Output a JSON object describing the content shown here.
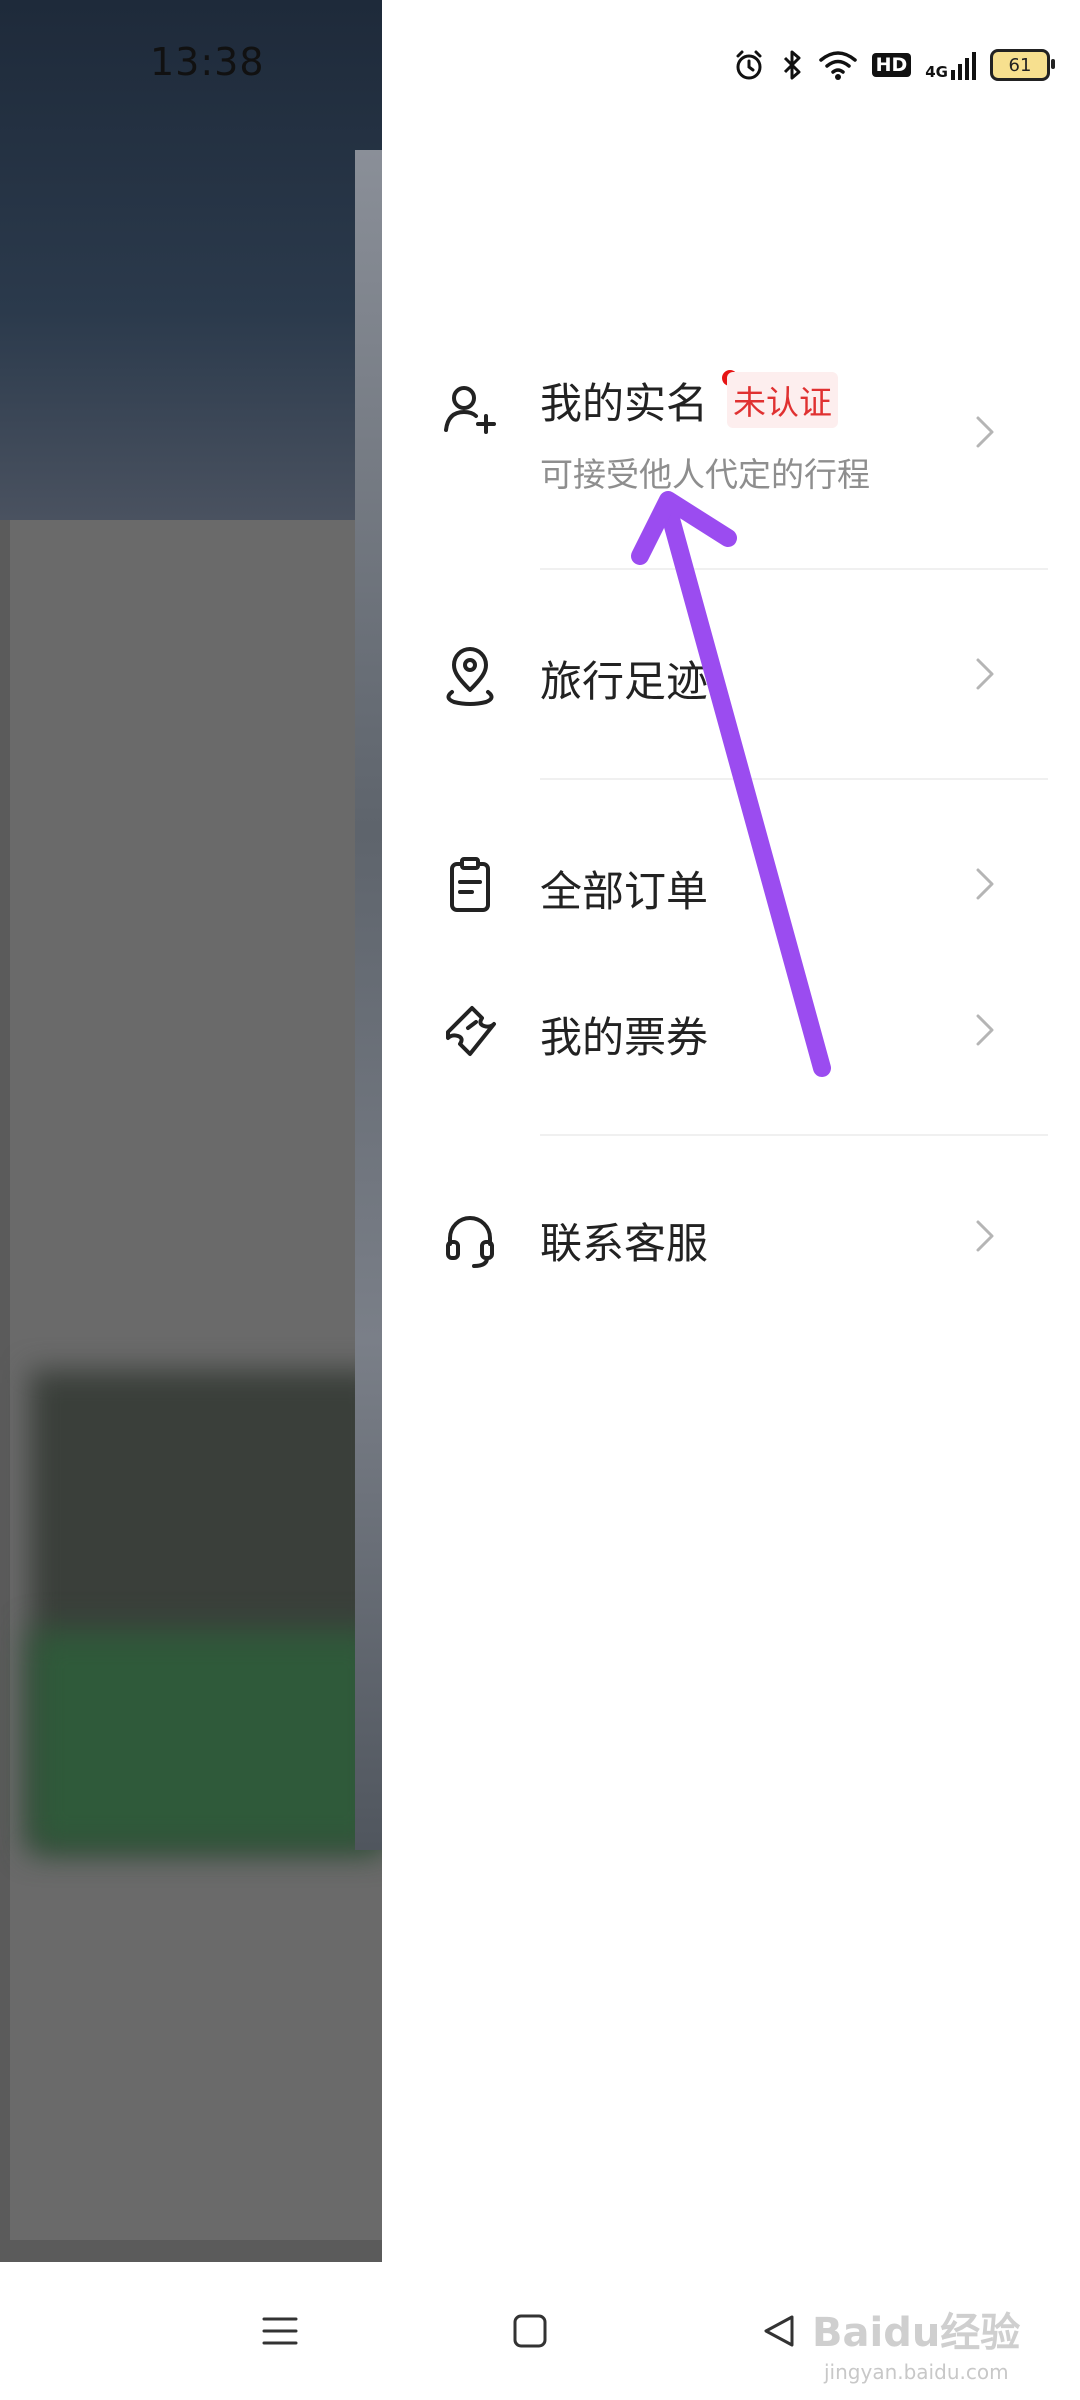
{
  "status_bar": {
    "time": "13:38",
    "battery": "61",
    "network": "4G",
    "hd": "HD"
  },
  "menu": {
    "items": [
      {
        "label": "我的实名",
        "subtitle": "可接受他人代定的行程",
        "badge": "未认证",
        "icon": "person-plus-icon"
      },
      {
        "label": "旅行足迹",
        "icon": "location-pin-icon"
      },
      {
        "label": "全部订单",
        "icon": "clipboard-icon"
      },
      {
        "label": "我的票券",
        "icon": "ticket-icon"
      },
      {
        "label": "联系客服",
        "icon": "headset-icon"
      }
    ]
  },
  "nav": {
    "buttons": [
      "menu-icon",
      "home-square-icon",
      "back-triangle-icon"
    ]
  },
  "watermark": {
    "brand": "Baidu经验",
    "site": "jingyan.baidu.com"
  },
  "colors": {
    "accent_red": "#e03131",
    "annotation_arrow": "#9b4cf0",
    "text_primary": "#222222",
    "text_secondary": "#8e8e8e"
  }
}
